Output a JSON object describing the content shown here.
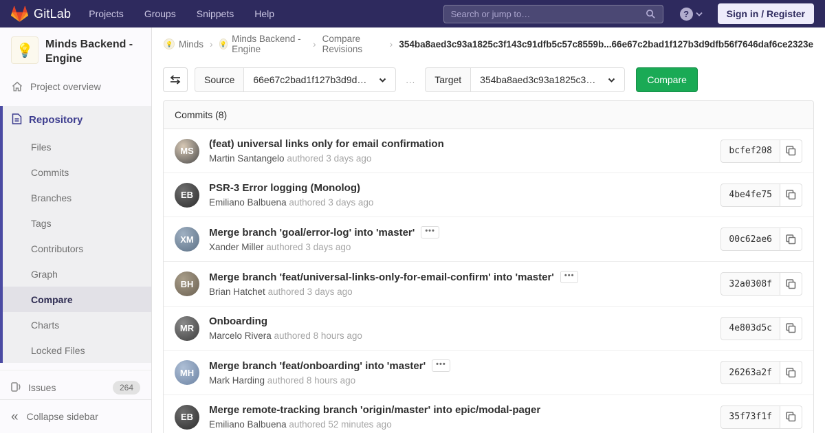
{
  "colors": {
    "navbar_bg": "#2e2a5e",
    "sidebar_accent": "#4b4ba3",
    "compare_button_green": "#1aaa55"
  },
  "navbar": {
    "logo_text": "GitLab",
    "links": [
      "Projects",
      "Groups",
      "Snippets",
      "Help"
    ],
    "search_placeholder": "Search or jump to…",
    "sign_in_label": "Sign in / Register"
  },
  "sidebar": {
    "project": {
      "name": "Minds Backend - Engine",
      "avatar_emoji": "💡"
    },
    "overview_label": "Project overview",
    "repository": {
      "label": "Repository",
      "items": [
        "Files",
        "Commits",
        "Branches",
        "Tags",
        "Contributors",
        "Graph",
        "Compare",
        "Charts",
        "Locked Files"
      ],
      "active_item": "Compare"
    },
    "issues": {
      "label": "Issues",
      "count": "264"
    },
    "collapse_label": "Collapse sidebar"
  },
  "breadcrumb": {
    "items": [
      {
        "label": "Minds"
      },
      {
        "label": "Minds Backend - Engine"
      },
      {
        "label": "Compare Revisions"
      },
      {
        "label": "354ba8aed3c93a1825c3f143c91dfb5c57c8559b...66e67c2bad1f127b3d9dfb56f7646daf6ce2323e"
      }
    ],
    "avatar_emoji": "💡"
  },
  "compare_form": {
    "source_label": "Source",
    "source_value": "66e67c2bad1f127b3d9d…",
    "separator": "...",
    "target_label": "Target",
    "target_value": "354ba8aed3c93a1825c3…",
    "compare_button_label": "Compare"
  },
  "commits": {
    "header": "Commits (8)",
    "items": [
      {
        "title": "(feat) universal links only for email confirmation",
        "author": "Martin Santangelo",
        "authored": "authored 3 days ago",
        "hash": "bcfef208",
        "expander": false,
        "initials": "MS",
        "avatar_light": "#d8c9b6",
        "avatar_dark": "#9a8а77"
      },
      {
        "title": "PSR-3 Error logging (Monolog)",
        "author": "Emiliano Balbuena",
        "authored": "authored 3 days ago",
        "hash": "4be4fe75",
        "expander": false,
        "initials": "EB",
        "avatar_light": "#6e6e6e",
        "avatar_dark": "#2d2d2d"
      },
      {
        "title": "Merge branch 'goal/error-log' into 'master'",
        "author": "Xander Miller",
        "authored": "authored 3 days ago",
        "hash": "00c62ae6",
        "expander": true,
        "initials": "XM",
        "avatar_light": "#9fb0c2",
        "avatar_dark": "#5d7186"
      },
      {
        "title": "Merge branch 'feat/universal-links-only-for-email-confirm' into 'master'",
        "author": "Brian Hatchet",
        "authored": "authored 3 days ago",
        "hash": "32a0308f",
        "expander": true,
        "initials": "BH",
        "avatar_light": "#a89d89",
        "avatar_dark": "#6b6152"
      },
      {
        "title": "Onboarding",
        "author": "Marcelo Rivera",
        "authored": "authored 8 hours ago",
        "hash": "4e803d5c",
        "expander": false,
        "initials": "MR",
        "avatar_light": "#8a8a8a",
        "avatar_dark": "#3e3e3e"
      },
      {
        "title": "Merge branch 'feat/onboarding' into 'master'",
        "author": "Mark Harding",
        "authored": "authored 8 hours ago",
        "hash": "26263a2f",
        "expander": true,
        "initials": "MH",
        "avatar_light": "#aebfd6",
        "avatar_dark": "#6c83a3"
      },
      {
        "title": "Merge remote-tracking branch 'origin/master' into epic/modal-pager",
        "author": "Emiliano Balbuena",
        "authored": "authored 52 minutes ago",
        "hash": "35f73f1f",
        "expander": false,
        "initials": "EB",
        "avatar_light": "#6e6e6e",
        "avatar_dark": "#2d2d2d"
      }
    ]
  }
}
